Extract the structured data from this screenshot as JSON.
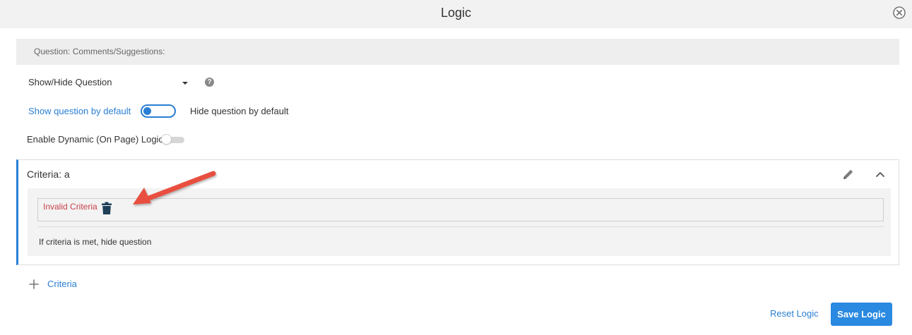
{
  "dialog": {
    "title": "Logic"
  },
  "question": {
    "label": "Question: Comments/Suggestions:"
  },
  "action_select": {
    "selected": "Show/Hide Question"
  },
  "visibility": {
    "show_label": "Show question by default",
    "hide_label": "Hide question by default"
  },
  "dynamic_logic": {
    "label": "Enable Dynamic (On Page) Logic"
  },
  "criteria": {
    "title": "Criteria: a",
    "invalid_text": "Invalid Criteria",
    "result_text": "If criteria is met, hide question"
  },
  "add_criteria": {
    "label": "Criteria"
  },
  "footer": {
    "reset_label": "Reset Logic",
    "save_label": "Save Logic"
  },
  "colors": {
    "accent": "#2a7fd4",
    "error": "#c9424a",
    "arrow": "#e8503f",
    "trash": "#1d3f57"
  },
  "icons": [
    "close-icon",
    "chevron-down-icon",
    "help-icon",
    "pencil-icon",
    "chevron-up-icon",
    "trash-icon",
    "plus-icon",
    "annotation-arrow"
  ]
}
